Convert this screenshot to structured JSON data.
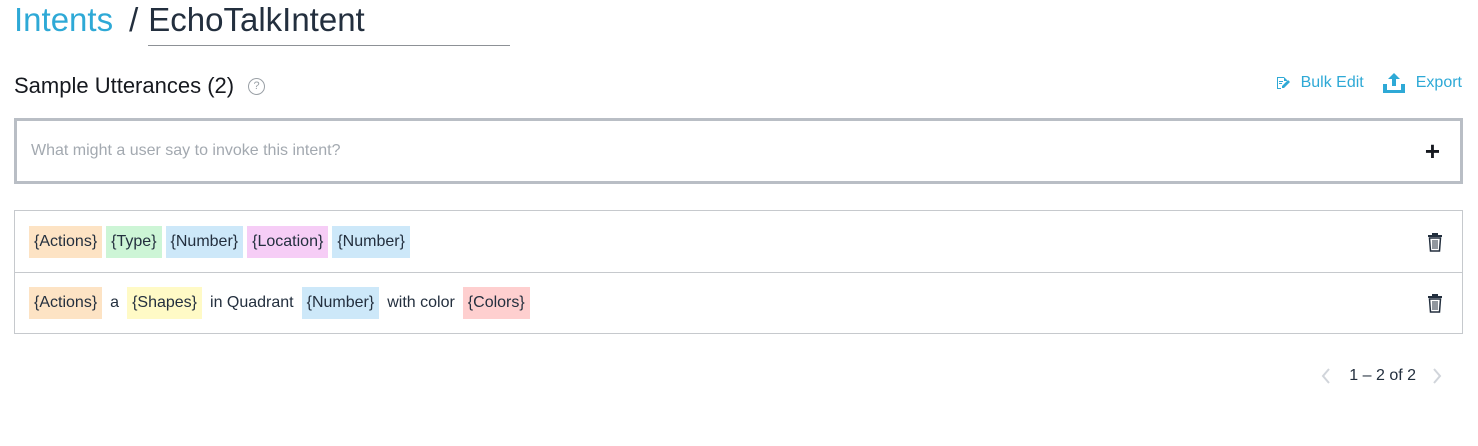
{
  "breadcrumb": {
    "parent": "Intents",
    "separator": "/",
    "current": "EchoTalkIntent"
  },
  "section": {
    "title": "Sample Utterances (2)",
    "help_icon": "question-circle-icon"
  },
  "actions": {
    "bulk_edit_label": "Bulk Edit",
    "bulk_edit_icon": "bulk-edit-icon",
    "export_label": "Export",
    "export_icon": "upload-icon"
  },
  "input": {
    "placeholder": "What might a user say to invoke this intent?",
    "value": "",
    "add_icon": "plus-icon",
    "add_glyph": "+"
  },
  "utterances": [
    {
      "tokens": [
        {
          "text": "{Actions}",
          "kind": "slot",
          "color": "#fde3c4"
        },
        {
          "text": "{Type}",
          "kind": "slot",
          "color": "#cdf5d6"
        },
        {
          "text": "{Number}",
          "kind": "slot",
          "color": "#cde8f9"
        },
        {
          "text": "{Location}",
          "kind": "slot",
          "color": "#f6cdf6"
        },
        {
          "text": "{Number}",
          "kind": "slot",
          "color": "#cde8f9"
        }
      ]
    },
    {
      "tokens": [
        {
          "text": "{Actions}",
          "kind": "slot",
          "color": "#fde3c4"
        },
        {
          "text": "a",
          "kind": "text"
        },
        {
          "text": "{Shapes}",
          "kind": "slot",
          "color": "#fffac6"
        },
        {
          "text": "in Quadrant",
          "kind": "text"
        },
        {
          "text": "{Number}",
          "kind": "slot",
          "color": "#cde8f9"
        },
        {
          "text": "with color",
          "kind": "text"
        },
        {
          "text": "{Colors}",
          "kind": "slot",
          "color": "#fecfcf"
        }
      ]
    }
  ],
  "pagination": {
    "text": "1 – 2 of 2",
    "prev_icon": "chevron-left-icon",
    "next_icon": "chevron-right-icon"
  },
  "colors": {
    "accent": "#2ea9d6",
    "border": "#c6c9cd"
  }
}
